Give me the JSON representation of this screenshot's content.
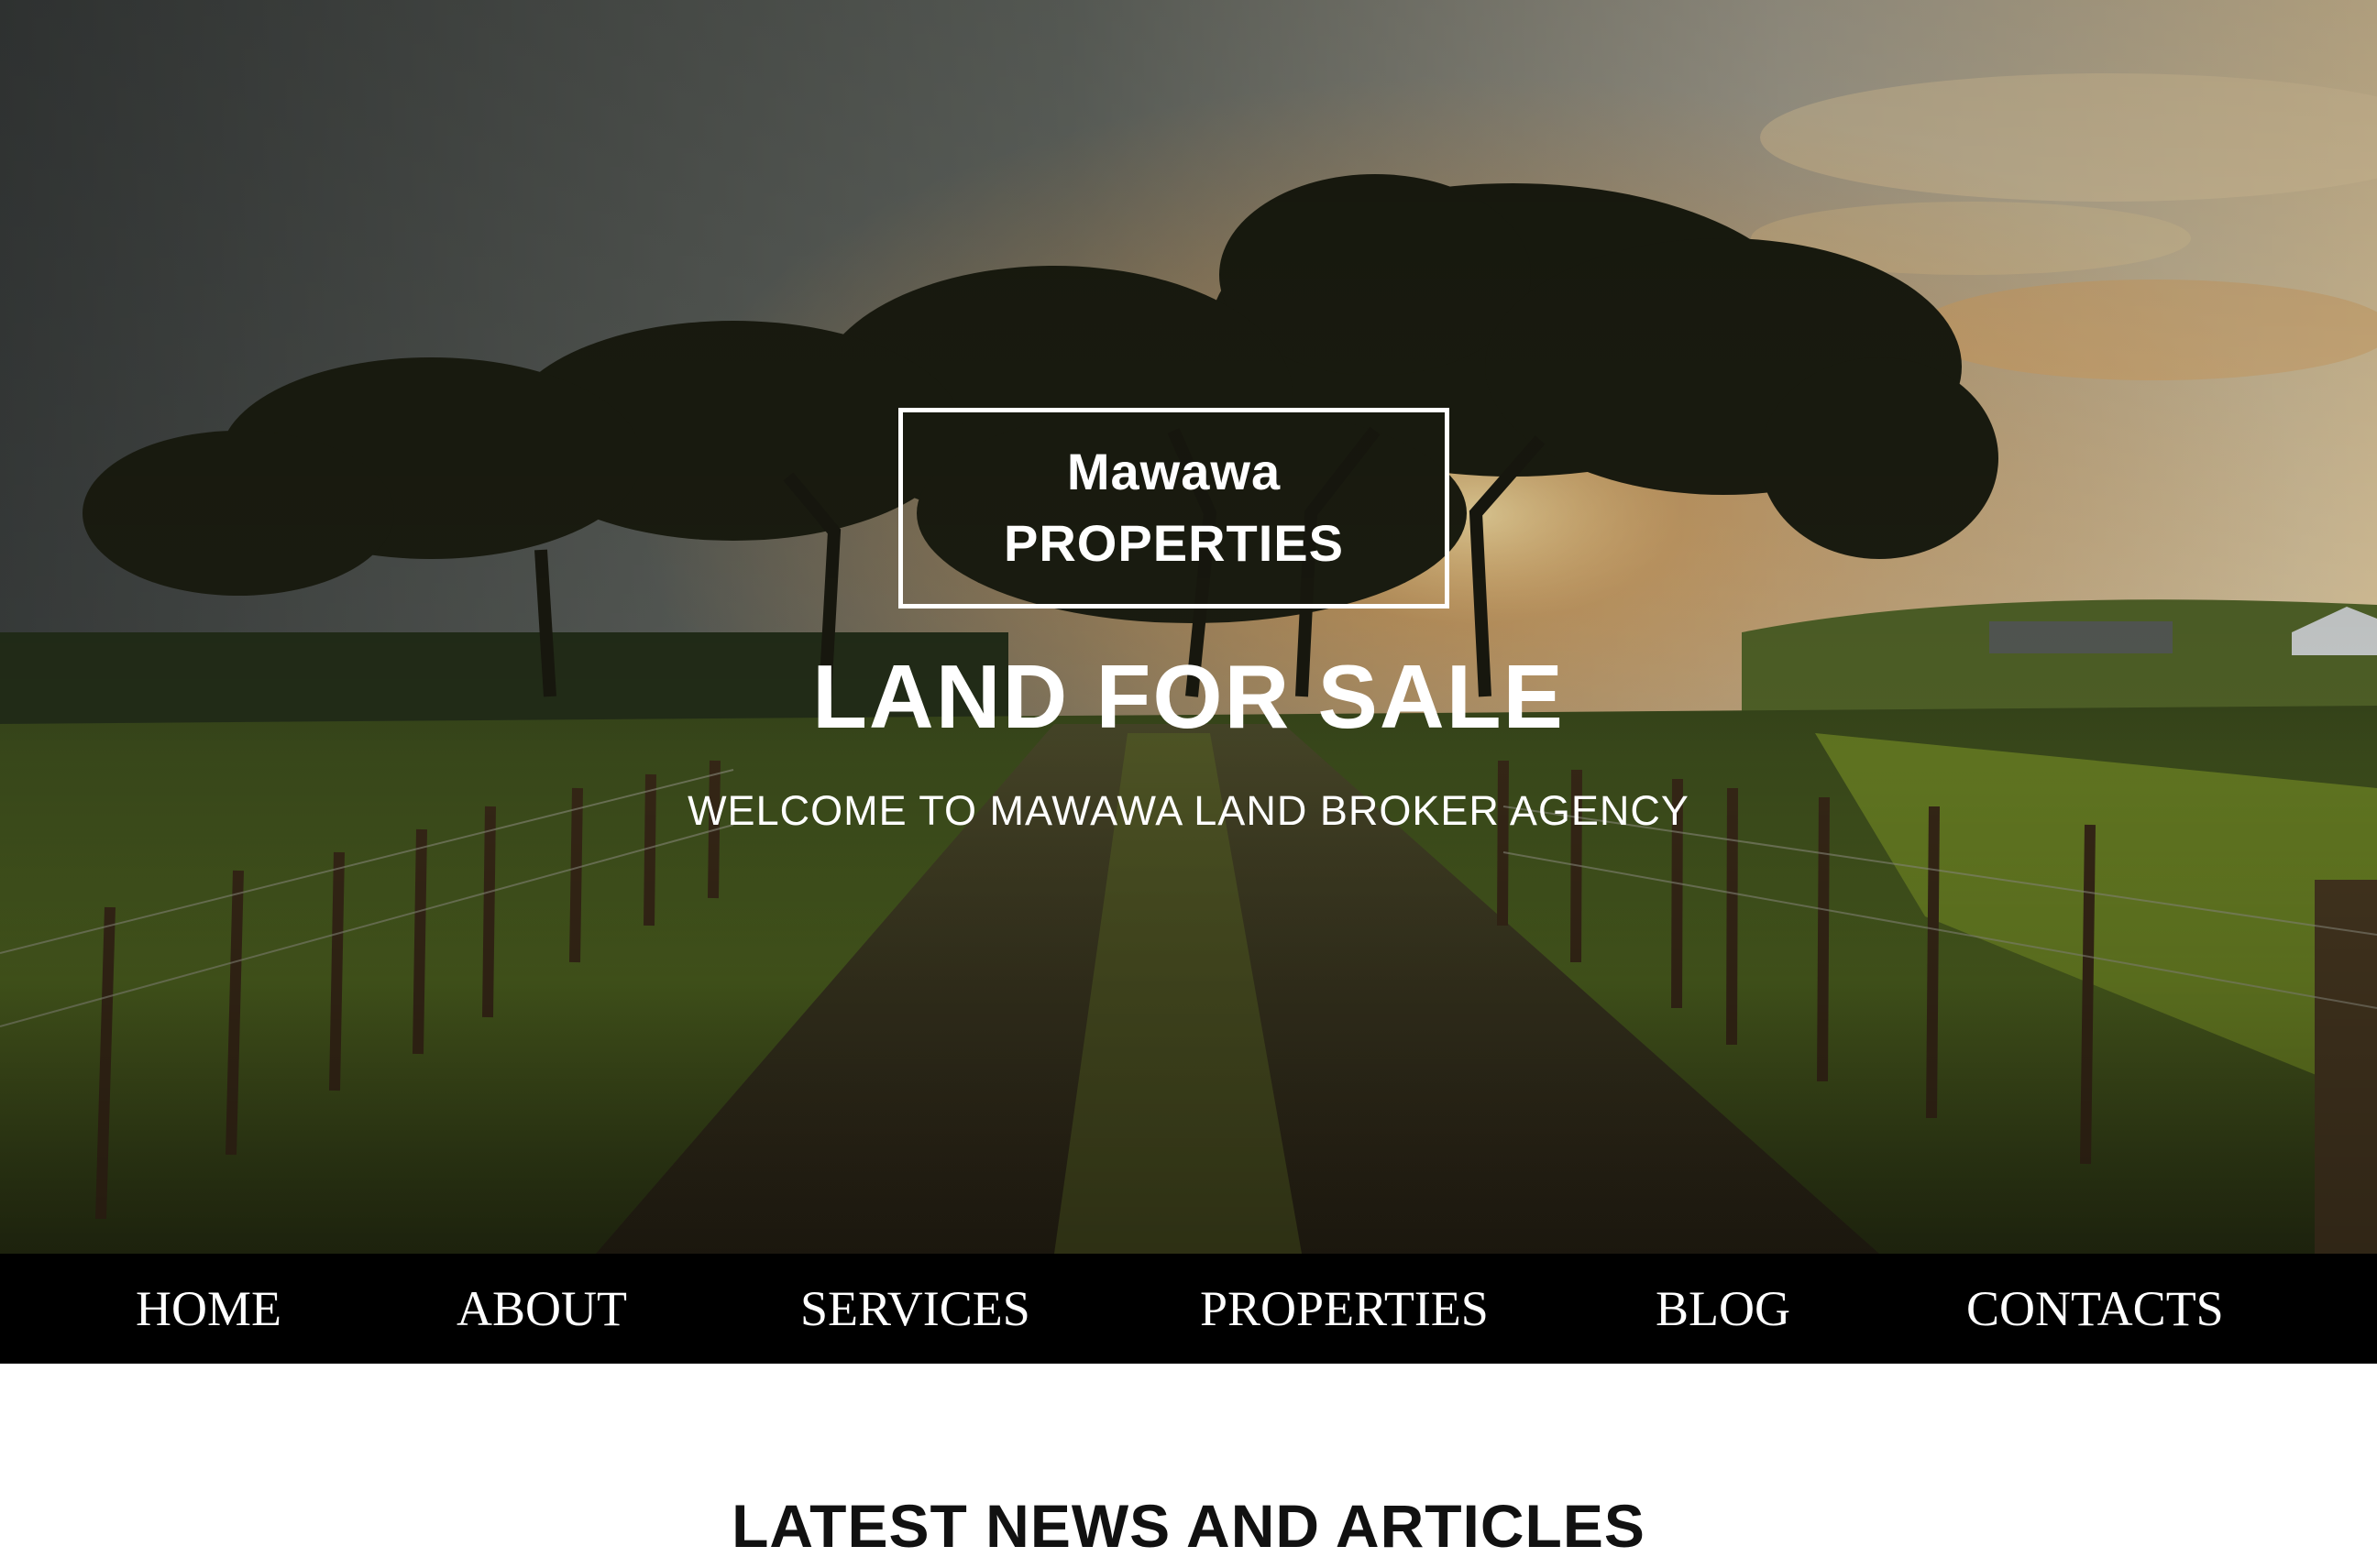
{
  "hero": {
    "background_image": "rural-dirt-road-with-fences-and-trees-at-sunset",
    "logo": {
      "line1": "Mawawa",
      "line2": "PROPERTIES"
    },
    "title": "LAND FOR SALE",
    "subtitle": "WELCOME TO MAWAWA LAND BROKER AGENCY"
  },
  "nav": {
    "items": [
      {
        "label": "HOME"
      },
      {
        "label": "ABOUT"
      },
      {
        "label": "SERVICES"
      },
      {
        "label": "PROPERTIES"
      },
      {
        "label": "BLOG"
      },
      {
        "label": "CONTACTS"
      }
    ]
  },
  "news": {
    "title": "LATEST NEWS AND ARTICLES"
  },
  "colors": {
    "nav_background": "#000000",
    "nav_text": "#ffffff",
    "hero_text": "#ffffff",
    "heading_text": "#111111"
  }
}
